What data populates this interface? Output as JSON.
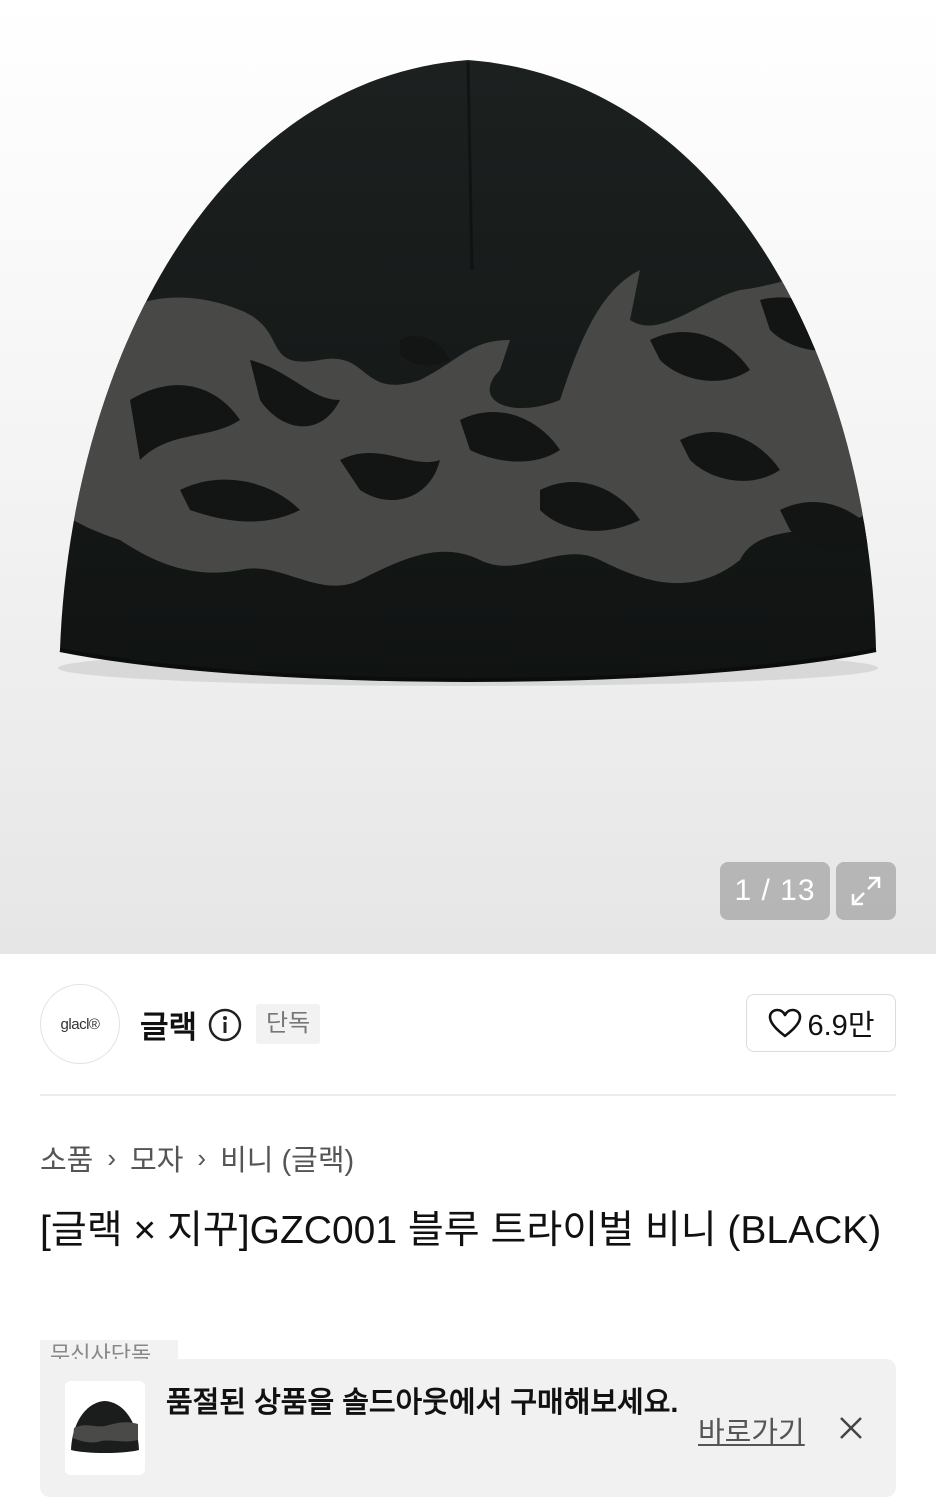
{
  "gallery": {
    "counter": "1 / 13",
    "expand_icon": "expand-icon"
  },
  "brand": {
    "logo_text": "glacl®",
    "name": "글랙",
    "info_icon": "info-icon",
    "exclusive_badge": "단독",
    "like_icon": "heart-icon",
    "like_count": "6.9만"
  },
  "breadcrumb": [
    "소품",
    "모자",
    "비니 (글랙)"
  ],
  "product": {
    "title": "[글랙 × 지꾸]GZC001 블루 트라이벌 비니 (BLACK)",
    "partial_tag": "무신사단독"
  },
  "toast": {
    "message": "품절된 상품을 솔드아웃에서 구매해보세요.",
    "link": "바로가기",
    "close_icon": "close-icon"
  }
}
